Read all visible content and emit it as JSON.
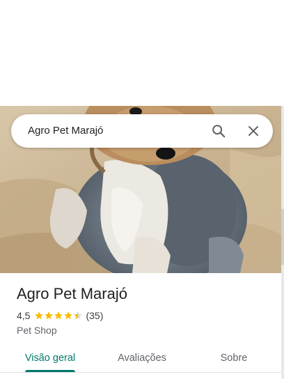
{
  "search": {
    "query": "Agro Pet Marajó"
  },
  "icons": {
    "search": "search-icon",
    "close": "close-icon",
    "star": "star-icon"
  },
  "place": {
    "name": "Agro Pet Marajó",
    "rating": "4,5",
    "rating_value": 4.5,
    "review_count": "(35)",
    "category": "Pet Shop"
  },
  "tabs": [
    {
      "label": "Visão geral",
      "active": true
    },
    {
      "label": "Avaliações",
      "active": false
    },
    {
      "label": "Sobre",
      "active": false
    }
  ],
  "colors": {
    "accent": "#00796b",
    "star": "#fbbc04",
    "star_empty": "#dadce0"
  }
}
